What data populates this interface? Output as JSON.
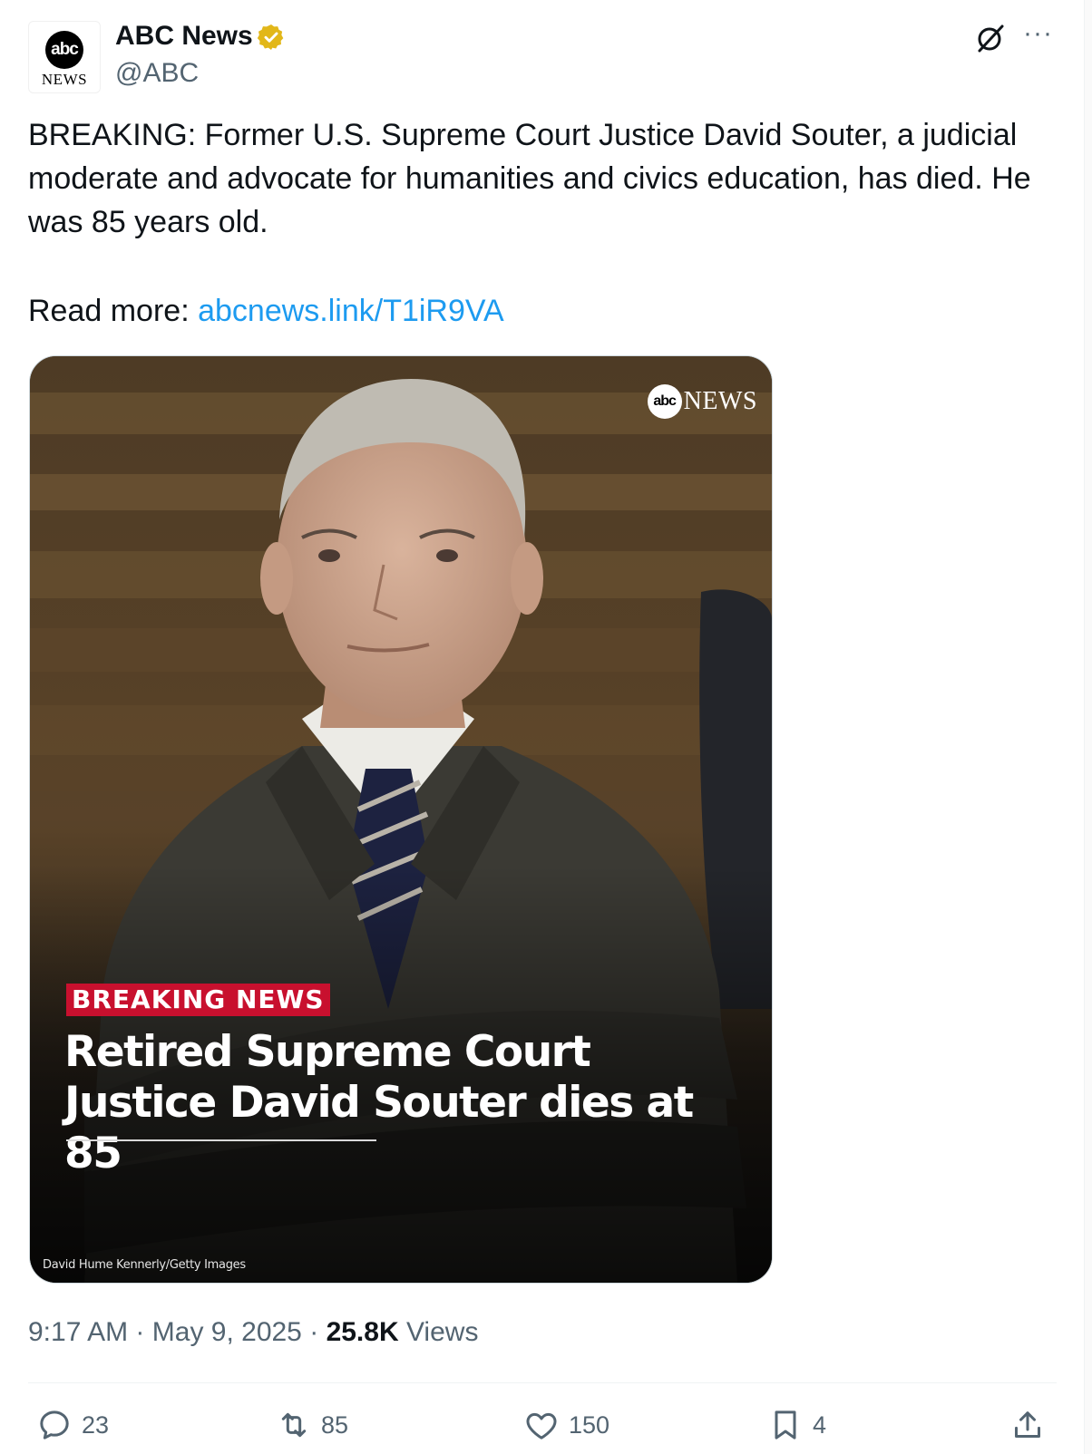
{
  "author": {
    "avatar_mark": "abc",
    "avatar_sub": "NEWS",
    "name": "ABC News",
    "handle": "@ABC",
    "verified_color": "#e2b719"
  },
  "post": {
    "text": "BREAKING: Former U.S. Supreme Court Justice David Souter, a judicial moderate and advocate for humanities and civics education, has died. He was 85 years old.",
    "read_more_label": "Read more:",
    "link_text": "abcnews.link/T1iR9VA"
  },
  "media": {
    "logo_mark": "abc",
    "logo_text": "NEWS",
    "badge": "BREAKING NEWS",
    "headline": "Retired Supreme Court Justice David Souter dies at 85",
    "credit": "David Hume Kennerly/Getty Images",
    "badge_color": "#c8102e"
  },
  "meta": {
    "time": "9:17 AM",
    "sep1": "·",
    "date": "May 9, 2025",
    "sep2": "·",
    "views_count": "25.8K",
    "views_label": "Views"
  },
  "actions": {
    "replies": "23",
    "reposts": "85",
    "likes": "150",
    "bookmarks": "4"
  },
  "icons": [
    "verified-badge-icon",
    "grok-icon",
    "more-icon",
    "reply-icon",
    "repost-icon",
    "like-icon",
    "bookmark-icon",
    "share-icon"
  ],
  "colors": {
    "link": "#1d9bf0",
    "muted": "#536471",
    "text": "#0f1419"
  }
}
